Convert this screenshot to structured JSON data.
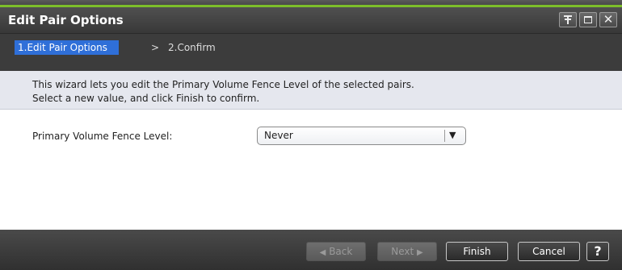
{
  "window": {
    "title": "Edit Pair Options"
  },
  "steps": [
    {
      "label": "1.Edit Pair Options",
      "active": true
    },
    {
      "label": "2.Confirm",
      "active": false
    }
  ],
  "step_separator": ">",
  "description": {
    "line1": "This wizard lets you edit the Primary Volume Fence Level of the selected pairs.",
    "line2": "Select a new value, and click Finish to confirm."
  },
  "form": {
    "fence_level_label": "Primary Volume Fence Level:",
    "fence_level_value": "Never"
  },
  "footer": {
    "back_label": "Back",
    "next_label": "Next",
    "finish_label": "Finish",
    "cancel_label": "Cancel",
    "help_label": "?"
  },
  "colors": {
    "accent": "#7dbf2a",
    "active_step": "#2f6fd8"
  },
  "icons": [
    "pin-icon",
    "maximize-icon",
    "close-icon",
    "chevron-down-icon",
    "back-arrow-icon",
    "next-arrow-icon"
  ]
}
